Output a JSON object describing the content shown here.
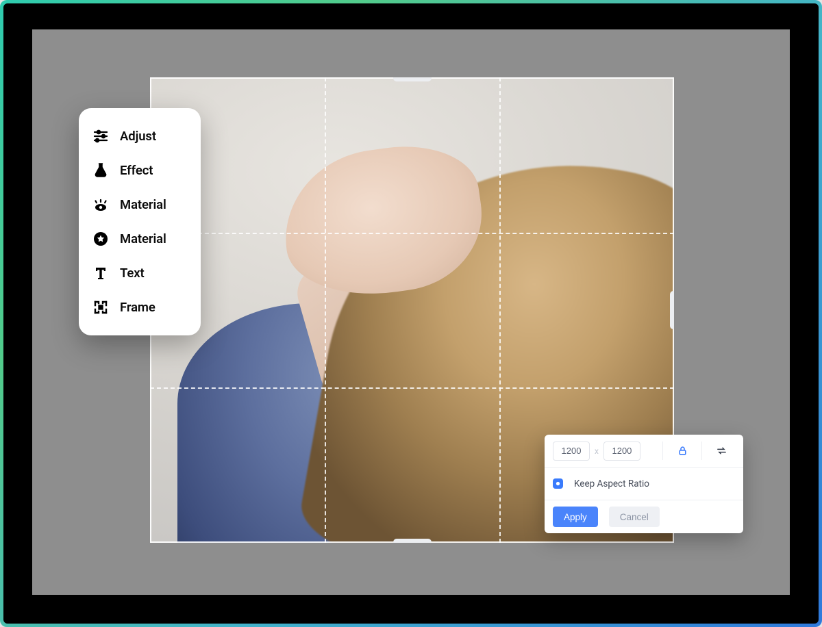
{
  "toolbar": {
    "items": [
      {
        "label": "Adjust",
        "icon": "sliders-icon"
      },
      {
        "label": "Effect",
        "icon": "flask-icon"
      },
      {
        "label": "Material",
        "icon": "eye-icon"
      },
      {
        "label": "Material",
        "icon": "star-circle-icon"
      },
      {
        "label": "Text",
        "icon": "text-icon"
      },
      {
        "label": "Frame",
        "icon": "frame-icon"
      }
    ]
  },
  "dimensions": {
    "width": "1200",
    "height": "1200",
    "separator": "x",
    "aspect_label": "Keep Aspect Ratio",
    "apply_label": "Apply",
    "cancel_label": "Cancel"
  },
  "colors": {
    "accent": "#4a84fb"
  }
}
